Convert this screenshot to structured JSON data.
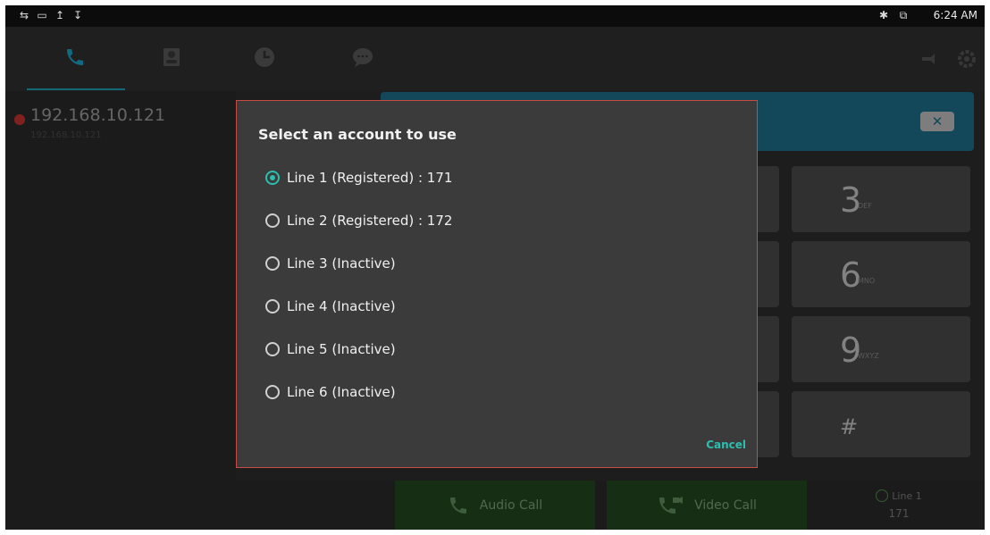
{
  "status_bar": {
    "time": "6:24 AM",
    "left_icons": [
      "network-icon",
      "screenshot-icon",
      "upload-icon",
      "download-icon"
    ],
    "right_icons": [
      "bluetooth-icon",
      "screen-mirror-icon"
    ]
  },
  "nav": {
    "tabs": [
      "phone-icon",
      "contacts-icon",
      "history-icon",
      "message-icon"
    ],
    "active_tab": "phone-icon",
    "right_icons": [
      "do-not-disturb-icon",
      "settings-icon"
    ]
  },
  "recent": {
    "ip": "192.168.10.121",
    "sub": "192.168.10.121"
  },
  "keypad": {
    "keys": [
      {
        "digit": "3",
        "letters": "DEF"
      },
      {
        "digit": "6",
        "letters": "MNO"
      },
      {
        "digit": "9",
        "letters": "WXYZ"
      },
      {
        "digit": "#",
        "letters": ""
      }
    ]
  },
  "bottom": {
    "audio_call": "Audio Call",
    "video_call": "Video Call",
    "line_label": "Line 1",
    "line_number": "171"
  },
  "dialog": {
    "title": "Select an account to use",
    "options": [
      {
        "label": "Line 1 (Registered) : 171",
        "selected": true
      },
      {
        "label": "Line 2 (Registered) : 172",
        "selected": false
      },
      {
        "label": "Line 3 (Inactive)",
        "selected": false
      },
      {
        "label": "Line 4 (Inactive)",
        "selected": false
      },
      {
        "label": "Line 5 (Inactive)",
        "selected": false
      },
      {
        "label": "Line 6 (Inactive)",
        "selected": false
      }
    ],
    "cancel_label": "Cancel"
  },
  "colors": {
    "accent": "#2bbfb0",
    "dialog_border": "#c74a44",
    "dial_bar": "#1c6f8a",
    "call_button": "#23481f"
  }
}
